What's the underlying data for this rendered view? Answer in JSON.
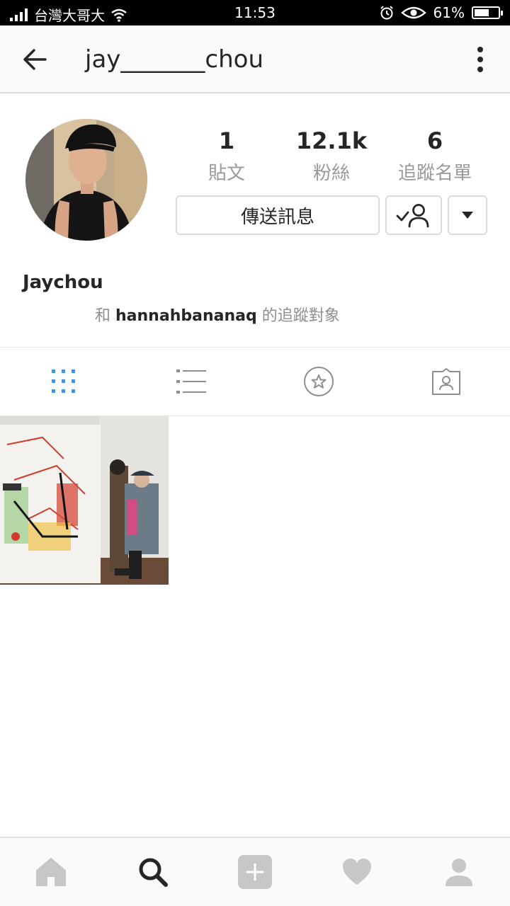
{
  "status_bar": {
    "carrier": "台灣大哥大",
    "time": "11:53",
    "battery": "61%",
    "battery_level": 0.61
  },
  "header": {
    "username": "jay_______chou"
  },
  "profile": {
    "stats": [
      {
        "value": "1",
        "label": "貼文"
      },
      {
        "value": "12.1k",
        "label": "粉絲"
      },
      {
        "value": "6",
        "label": "追蹤名單"
      }
    ],
    "message_button": "傳送訊息",
    "display_name": "Jaychou",
    "mutual": {
      "prefix": "和",
      "user": "hannahbananaq",
      "suffix": "的追蹤對象"
    }
  },
  "tabs": [
    {
      "icon": "grid-icon",
      "active": true
    },
    {
      "icon": "list-icon",
      "active": false
    },
    {
      "icon": "saved-star-icon",
      "active": false
    },
    {
      "icon": "tagged-icon",
      "active": false
    }
  ],
  "nav": [
    {
      "icon": "home-icon"
    },
    {
      "icon": "search-icon",
      "active": true
    },
    {
      "icon": "add-icon"
    },
    {
      "icon": "heart-icon"
    },
    {
      "icon": "profile-icon"
    }
  ],
  "colors": {
    "accent": "#3897f0",
    "muted": "#999999",
    "text": "#262626"
  }
}
